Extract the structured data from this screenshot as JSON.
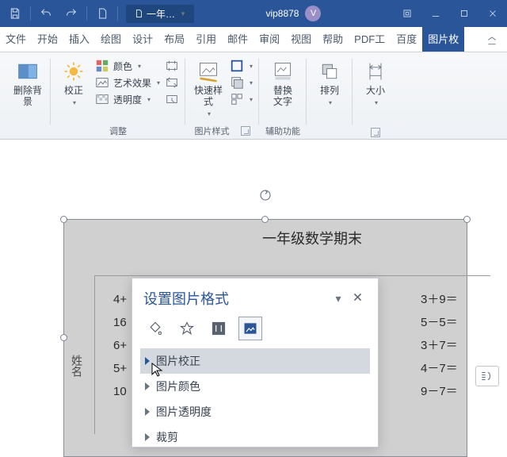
{
  "titlebar": {
    "doc_name": "一年…",
    "username": "vip8878",
    "avatar_initial": "V"
  },
  "tabs": {
    "items": [
      "文件",
      "开始",
      "插入",
      "绘图",
      "设计",
      "布局",
      "引用",
      "邮件",
      "审阅",
      "视图",
      "帮助",
      "PDF工",
      "百度",
      "图片枚"
    ],
    "active_index": 13
  },
  "ribbon": {
    "remove_bg": "删除背景",
    "correct": "校正",
    "color": "颜色",
    "art_fx": "艺术效果",
    "transparency": "透明度",
    "adjust_label": "调整",
    "quick_style": "快速样式",
    "pic_style_label": "图片样式",
    "alt_text_l1": "替换",
    "alt_text_l2": "文字",
    "acc_label": "辅助功能",
    "arrange": "排列",
    "size": "大小"
  },
  "doc": {
    "title": "一年级数学期末",
    "left_frag": [
      "4+",
      "16",
      "6+",
      "5+",
      "10"
    ],
    "right_frag": [
      "3＋9＝",
      "5－5＝",
      "3＋7＝",
      "4－7＝",
      "9－7＝"
    ],
    "side_label": "姓名"
  },
  "pane": {
    "title": "设置图片格式",
    "items": [
      "图片校正",
      "图片颜色",
      "图片透明度",
      "裁剪"
    ],
    "selected_index": 0
  }
}
